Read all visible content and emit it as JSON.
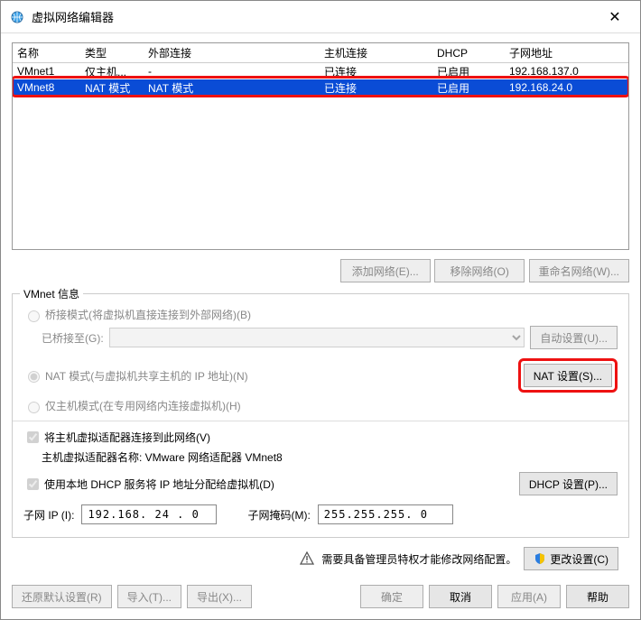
{
  "window": {
    "title": "虚拟网络编辑器"
  },
  "table": {
    "headers": {
      "name": "名称",
      "type": "类型",
      "ext": "外部连接",
      "host": "主机连接",
      "dhcp": "DHCP",
      "subnet": "子网地址"
    },
    "rows": [
      {
        "name": "VMnet1",
        "type": "仅主机...",
        "ext": "-",
        "host": "已连接",
        "dhcp": "已启用",
        "subnet": "192.168.137.0",
        "selected": false
      },
      {
        "name": "VMnet8",
        "type": "NAT 模式",
        "ext": "NAT 模式",
        "host": "已连接",
        "dhcp": "已启用",
        "subnet": "192.168.24.0",
        "selected": true
      }
    ]
  },
  "buttons": {
    "addNet": "添加网络(E)...",
    "removeNet": "移除网络(O)",
    "renameNet": "重命名网络(W)...",
    "autoBridge": "自动设置(U)...",
    "natSettings": "NAT 设置(S)...",
    "dhcpSettings": "DHCP 设置(P)...",
    "changeSettings": "更改设置(C)",
    "restore": "还原默认设置(R)",
    "import": "导入(T)...",
    "export": "导出(X)...",
    "ok": "确定",
    "cancel": "取消",
    "apply": "应用(A)",
    "help": "帮助"
  },
  "group": {
    "title": "VMnet 信息",
    "bridge": "桥接模式(将虚拟机直接连接到外部网络)(B)",
    "bridgedTo": "已桥接至(G):",
    "nat": "NAT 模式(与虚拟机共享主机的 IP 地址)(N)",
    "hostonly": "仅主机模式(在专用网络内连接虚拟机)(H)",
    "connectHost": "将主机虚拟适配器连接到此网络(V)",
    "hostAdapterLabel": "主机虚拟适配器名称: VMware 网络适配器 VMnet8",
    "useDhcp": "使用本地 DHCP 服务将 IP 地址分配给虚拟机(D)",
    "subnetIp": "子网 IP (I):",
    "subnetMask": "子网掩码(M):",
    "ipValue": "192.168. 24 . 0",
    "maskValue": "255.255.255. 0"
  },
  "admin": {
    "note": "需要具备管理员特权才能修改网络配置。"
  }
}
